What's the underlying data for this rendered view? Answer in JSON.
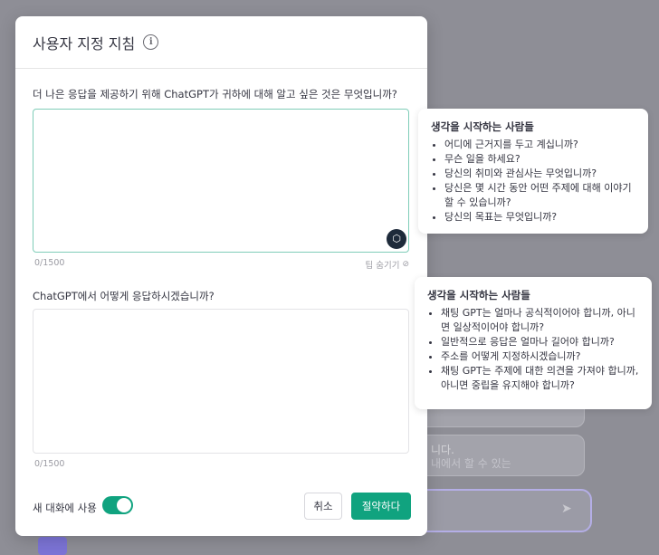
{
  "background": {
    "partial_text_1": "니다.",
    "partial_text_2": "내에서 할 수 있는"
  },
  "modal": {
    "title": "사용자 지정 지침",
    "info_icon": "info-icon",
    "q1_label": "더 나은 응답을 제공하기 위해 ChatGPT가 귀하에 대해 알고 싶은 것은 무엇입니까?",
    "q1_value": "",
    "q1_counter": "0/1500",
    "hide_tips_label": "팁 숨기기",
    "q2_label": "ChatGPT에서 어떻게 응답하시겠습니까?",
    "q2_value": "",
    "q2_counter": "0/1500",
    "new_chat_label": "새 대화에 사용",
    "toggle_on": true,
    "cancel_label": "취소",
    "save_label": "절약하다"
  },
  "tips": [
    {
      "title": "생각을 시작하는 사람들",
      "items": [
        "어디에 근거지를 두고 계십니까?",
        "무슨 일을 하세요?",
        "당신의 취미와 관심사는 무엇입니까?",
        "당신은 몇 시간 동안 어떤 주제에 대해 이야기할 수 있습니까?",
        "당신의 목표는 무엇입니까?"
      ]
    },
    {
      "title": "생각을 시작하는 사람들",
      "items": [
        "채팅 GPT는 얼마나 공식적이어야 합니까, 아니면 일상적이어야 합니까?",
        "일반적으로 응답은 얼마나 길어야 합니까?",
        "주소를 어떻게 지정하시겠습니까?",
        "채팅 GPT는 주제에 대한 의견을 가져야 합니까, 아니면 중립을 유지해야 합니까?"
      ]
    }
  ],
  "colors": {
    "accent": "#10a37f",
    "focus_border": "#7fcdb8"
  }
}
